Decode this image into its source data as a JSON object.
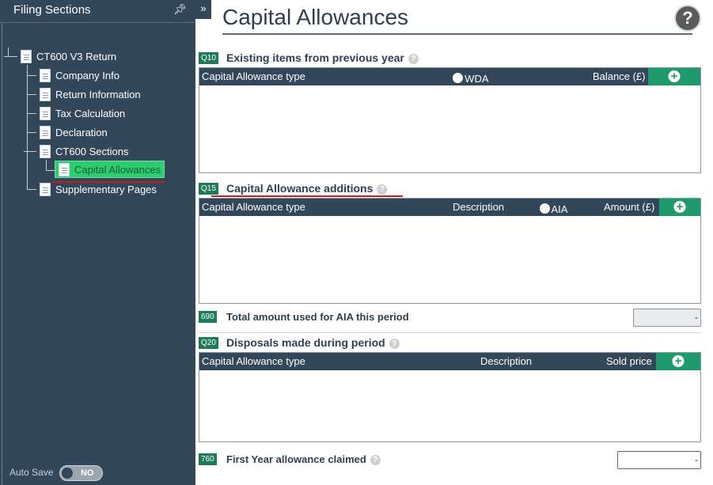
{
  "sidebar": {
    "title": "Filing Sections",
    "pin_icon": "pin-icon",
    "tree": {
      "root": "CT600 V3 Return",
      "items": [
        "Company Info",
        "Return Information",
        "Tax Calculation",
        "Declaration",
        "CT600 Sections"
      ],
      "child": "Capital Allowances",
      "last": "Supplementary Pages"
    },
    "autosave_label": "Auto Save",
    "autosave_value": "NO"
  },
  "collapse_glyph": "»",
  "main": {
    "title": "Capital Allowances",
    "help_glyph": "?",
    "q10": {
      "badge": "Q10",
      "title": "Existing items from previous year",
      "columns": [
        "Capital Allowance type",
        "% WDA",
        "Balance (£)"
      ]
    },
    "q15": {
      "badge": "Q15",
      "title": "Capital Allowance additions",
      "columns": [
        "Capital Allowance type",
        "Description",
        "% AIA",
        "Amount (£)"
      ]
    },
    "f690": {
      "badge": "690",
      "label": "Total amount used for AIA this period",
      "value": "-"
    },
    "q20": {
      "badge": "Q20",
      "title": "Disposals made during period",
      "columns": [
        "Capital Allowance type",
        "Description",
        "Sold price"
      ]
    },
    "f760": {
      "badge": "760",
      "label": "First Year allowance claimed",
      "value": "-"
    }
  },
  "colors": {
    "sidebar_bg": "#33475a",
    "badge_green": "#1f7a5a",
    "add_green": "#1f9a6d",
    "active_green": "#2ecc71",
    "annotation_red": "#c81e1e"
  }
}
